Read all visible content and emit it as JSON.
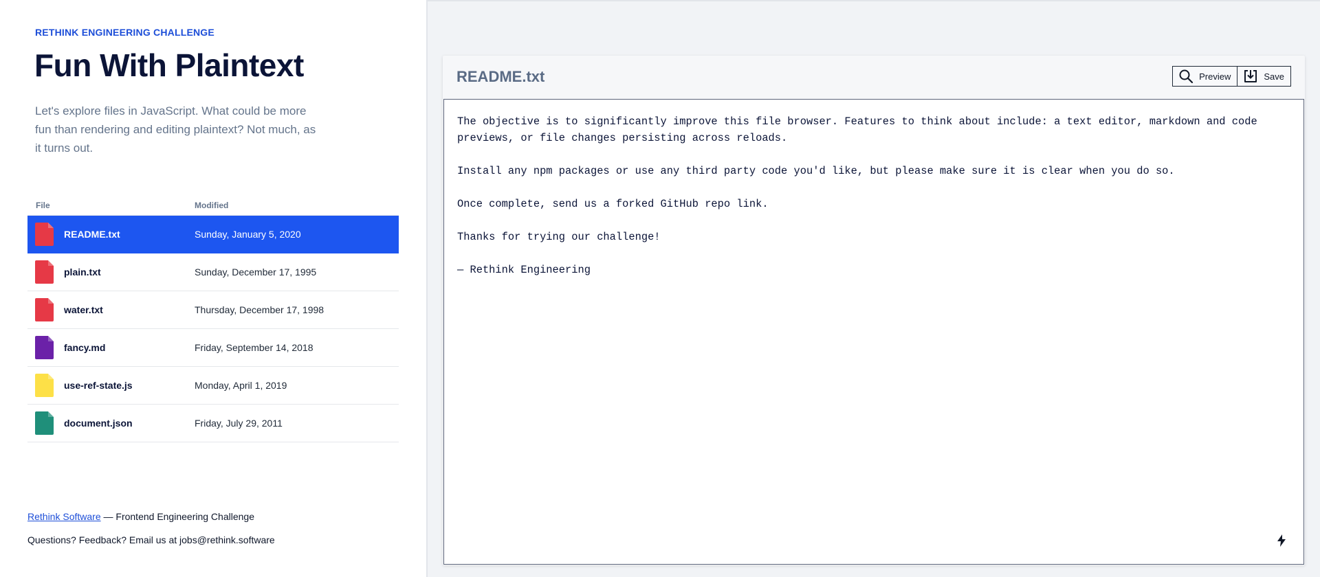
{
  "header": {
    "eyebrow": "RETHINK ENGINEERING CHALLENGE",
    "title": "Fun With Plaintext",
    "intro": "Let's explore files in JavaScript. What could be more fun than rendering and editing plaintext? Not much, as it turns out."
  },
  "table": {
    "columns": {
      "file": "File",
      "modified": "Modified"
    },
    "rows": [
      {
        "name": "README.txt",
        "modified": "Sunday, January 5, 2020",
        "color": "#e63946",
        "selected": true
      },
      {
        "name": "plain.txt",
        "modified": "Sunday, December 17, 1995",
        "color": "#e63946"
      },
      {
        "name": "water.txt",
        "modified": "Thursday, December 17, 1998",
        "color": "#e63946"
      },
      {
        "name": "fancy.md",
        "modified": "Friday, September 14, 2018",
        "color": "#6b21a8"
      },
      {
        "name": "use-ref-state.js",
        "modified": "Monday, April 1, 2019",
        "color": "#fde047"
      },
      {
        "name": "document.json",
        "modified": "Friday, July 29, 2011",
        "color": "#1f8f7a"
      }
    ]
  },
  "footer": {
    "link": "Rethink Software",
    "tagline": " — Frontend Engineering Challenge",
    "contact": "Questions? Feedback? Email us at jobs@rethink.software"
  },
  "viewer": {
    "title": "README.txt",
    "preview_label": "Preview",
    "save_label": "Save",
    "content": "The objective is to significantly improve this file browser. Features to think about include: a text editor, markdown and code previews, or file changes persisting across reloads.\n\nInstall any npm packages or use any third party code you'd like, but please make sure it is clear when you do so.\n\nOnce complete, send us a forked GitHub repo link.\n\nThanks for trying our challenge!\n\n— Rethink Engineering"
  },
  "colors": {
    "accent": "#1d56f0",
    "link": "#1d4ed8"
  },
  "icons": {
    "file": "file-icon",
    "preview": "search-icon",
    "save": "download-icon",
    "corner": "lightning-icon"
  }
}
